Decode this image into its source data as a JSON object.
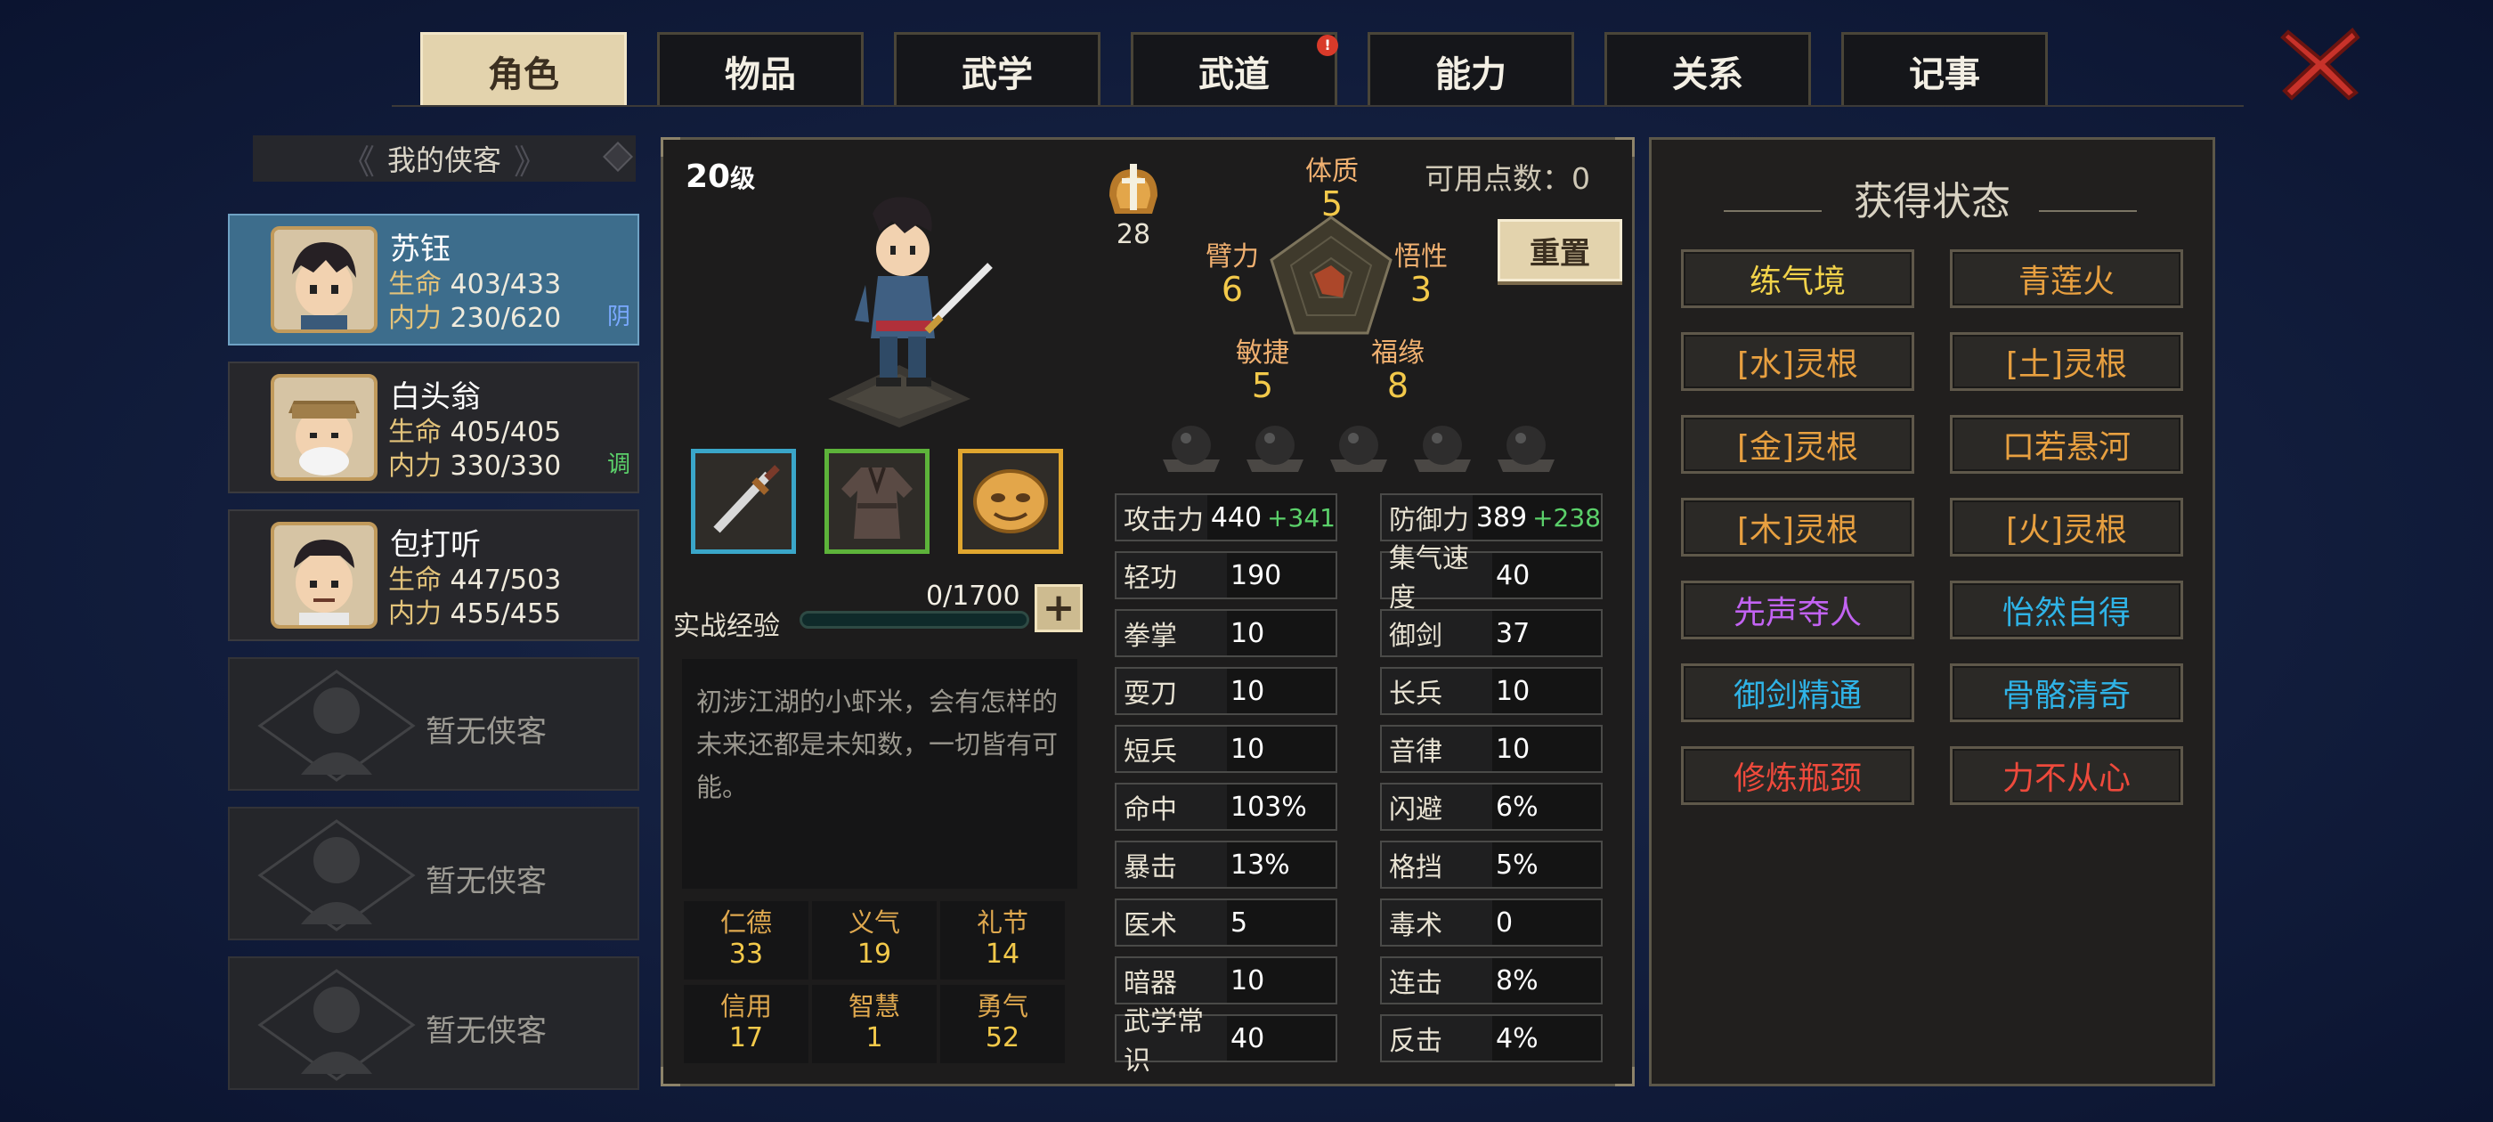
{
  "tabs": [
    {
      "label": "角色",
      "active": true
    },
    {
      "label": "物品"
    },
    {
      "label": "武学"
    },
    {
      "label": "武道",
      "badge": "!"
    },
    {
      "label": "能力"
    },
    {
      "label": "关系"
    },
    {
      "label": "记事"
    }
  ],
  "sidebar": {
    "title": "我的侠客",
    "heroes": [
      {
        "name": "苏钰",
        "hp_label": "生命",
        "hp": "403/433",
        "mp_label": "内力",
        "mp": "230/620",
        "tag": "阴",
        "tag_color": "#7aa9ff"
      },
      {
        "name": "白头翁",
        "hp_label": "生命",
        "hp": "405/405",
        "mp_label": "内力",
        "mp": "330/330",
        "tag": "调",
        "tag_color": "#5bd06a"
      },
      {
        "name": "包打听",
        "hp_label": "生命",
        "hp": "447/503",
        "mp_label": "内力",
        "mp": "455/455",
        "tag": ""
      }
    ],
    "empty_label": "暂无侠客"
  },
  "character": {
    "level": "20",
    "level_unit": "级",
    "badge_value": "28",
    "points_label": "可用点数：0",
    "reset_label": "重置",
    "attributes": {
      "tizhi": {
        "name": "体质",
        "value": "5"
      },
      "wuxing": {
        "name": "悟性",
        "value": "3"
      },
      "fuyuan": {
        "name": "福缘",
        "value": "8"
      },
      "minjie": {
        "name": "敏捷",
        "value": "5"
      },
      "bili": {
        "name": "臂力",
        "value": "6"
      }
    },
    "exp_label": "实战经验",
    "exp_value": "0/1700",
    "exp_fraction": 0,
    "description": "初涉江湖的小虾米，会有怎样的未来还都是未知数，一切皆有可能。",
    "virtues": [
      {
        "name": "仁德",
        "value": "33"
      },
      {
        "name": "义气",
        "value": "19"
      },
      {
        "name": "礼节",
        "value": "14"
      },
      {
        "name": "信用",
        "value": "17"
      },
      {
        "name": "智慧",
        "value": "1"
      },
      {
        "name": "勇气",
        "value": "52"
      }
    ],
    "stats_left": [
      {
        "k": "攻击力",
        "v": "440",
        "bonus": "+341"
      },
      {
        "k": "轻功",
        "v": "190"
      },
      {
        "k": "拳掌",
        "v": "10"
      },
      {
        "k": "耍刀",
        "v": "10"
      },
      {
        "k": "短兵",
        "v": "10"
      },
      {
        "k": "命中",
        "v": "103%"
      },
      {
        "k": "暴击",
        "v": "13%"
      },
      {
        "k": "医术",
        "v": "5"
      },
      {
        "k": "暗器",
        "v": "10"
      },
      {
        "k": "武学常识",
        "v": "40"
      }
    ],
    "stats_right": [
      {
        "k": "防御力",
        "v": "389",
        "bonus": "+238"
      },
      {
        "k": "集气速度",
        "v": "40"
      },
      {
        "k": "御剑",
        "v": "37"
      },
      {
        "k": "长兵",
        "v": "10"
      },
      {
        "k": "音律",
        "v": "10"
      },
      {
        "k": "闪避",
        "v": "6%"
      },
      {
        "k": "格挡",
        "v": "5%"
      },
      {
        "k": "毒术",
        "v": "0"
      },
      {
        "k": "连击",
        "v": "8%"
      },
      {
        "k": "反击",
        "v": "4%"
      }
    ]
  },
  "status_panel": {
    "title": "获得状态",
    "items": [
      {
        "label": "练气境",
        "color": "#f2d34a"
      },
      {
        "label": "青莲火",
        "color": "#e8a040"
      },
      {
        "label": "[水]灵根",
        "color": "#e8a040"
      },
      {
        "label": "[土]灵根",
        "color": "#e8a040"
      },
      {
        "label": "[金]灵根",
        "color": "#e8a040"
      },
      {
        "label": "口若悬河",
        "color": "#e8a040"
      },
      {
        "label": "[木]灵根",
        "color": "#e8a040"
      },
      {
        "label": "[火]灵根",
        "color": "#e8a040"
      },
      {
        "label": "先声夺人",
        "color": "#c263f2"
      },
      {
        "label": "怡然自得",
        "color": "#2fb3e6"
      },
      {
        "label": "御剑精通",
        "color": "#2fb3e6"
      },
      {
        "label": "骨骼清奇",
        "color": "#2fb3e6"
      },
      {
        "label": "修炼瓶颈",
        "color": "#ee4a3c"
      },
      {
        "label": "力不从心",
        "color": "#ee4a3c"
      }
    ]
  }
}
